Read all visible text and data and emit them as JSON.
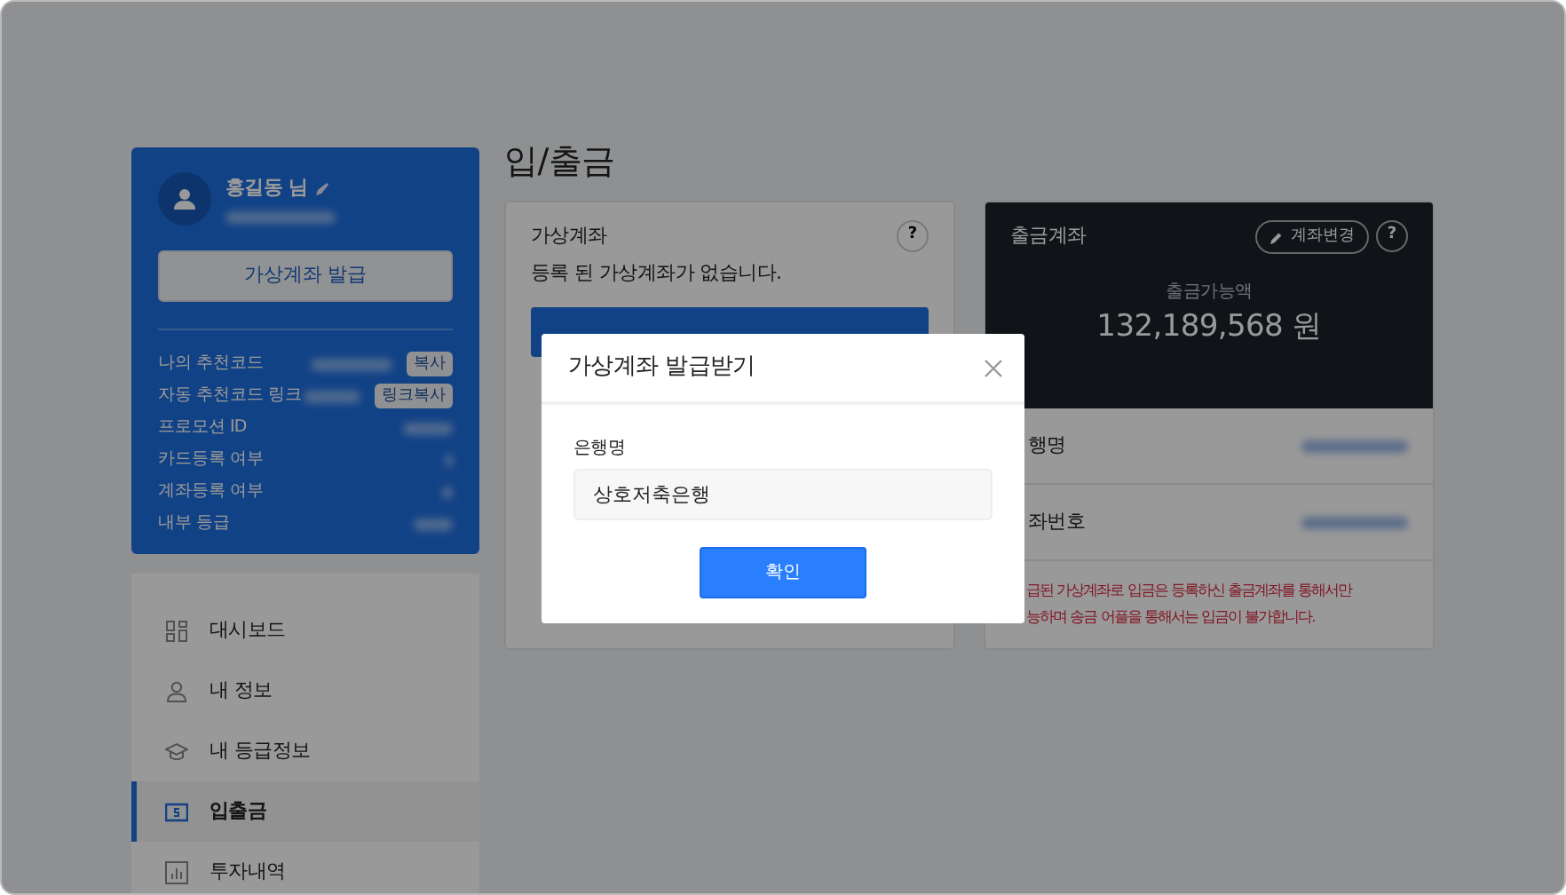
{
  "profile": {
    "name": "홍길동 님",
    "button": "가상계좌 발급",
    "rows": [
      {
        "label": "나의 추천코드",
        "action": "복사"
      },
      {
        "label": "자동 추천코드 링크",
        "action": "링크복사"
      },
      {
        "label": "프로모션 ID"
      },
      {
        "label": "카드등록 여부"
      },
      {
        "label": "계좌등록 여부"
      },
      {
        "label": "내부 등급"
      }
    ]
  },
  "menu": [
    {
      "label": "대시보드",
      "kind": "dashboard",
      "selected": false
    },
    {
      "label": "내 정보",
      "kind": "person",
      "selected": false
    },
    {
      "label": "내 등급정보",
      "kind": "cap",
      "selected": false
    },
    {
      "label": "입출금",
      "kind": "money",
      "selected": true
    },
    {
      "label": "투자내역",
      "kind": "chart",
      "selected": false
    }
  ],
  "page_title": "입/출금",
  "virtual_account": {
    "title": "가상계좌",
    "help": "?",
    "message": "등록 된 가상계좌가 없습니다."
  },
  "withdraw_account": {
    "title": "출금계좌",
    "change_button": "계좌변경",
    "help": "?",
    "balance_label": "출금가능액",
    "balance": "132,189,568 원",
    "rows": [
      {
        "label": "행명"
      },
      {
        "label": "좌번호"
      }
    ],
    "notice": [
      "급된 가상계좌로 입금은 등록하신 출금계좌를 통해서만",
      "능하며 송금 어플을 통해서는 입금이 불가합니다."
    ]
  },
  "modal": {
    "title": "가상계좌 발급받기",
    "field_label": "은행명",
    "field_value": "상호저축은행",
    "confirm": "확인"
  }
}
